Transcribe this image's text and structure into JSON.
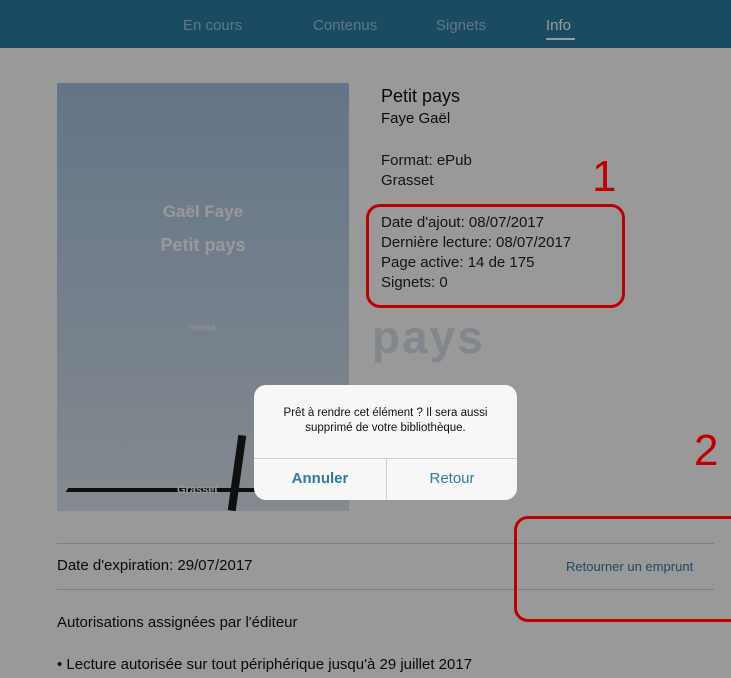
{
  "nav": {
    "tabs": [
      {
        "label": "En cours"
      },
      {
        "label": "Contenus"
      },
      {
        "label": "Signets"
      },
      {
        "label": "Info"
      }
    ],
    "active_tab": "Info"
  },
  "cover": {
    "author": "Gaël Faye",
    "title": "Petit pays",
    "subtitle": "roman",
    "publisher": "Grasset"
  },
  "book": {
    "title": "Petit pays",
    "author": "Faye Gaël",
    "format": "Format: ePub",
    "publisher": "Grasset",
    "date_added": "Date d'ajout: 08/07/2017",
    "last_read": "Dernière lecture: 08/07/2017",
    "active_page": "Page active: 14 de 175",
    "bookmarks": "Signets: 0"
  },
  "watermark": "pays",
  "annotations": {
    "one": "1",
    "two": "2"
  },
  "loan": {
    "expiration": "Date d'expiration: 29/07/2017",
    "return_link": "Retourner un emprunt"
  },
  "permissions": {
    "heading": "Autorisations assignées par l'éditeur",
    "item": "• Lecture autorisée sur tout périphérique jusqu'à 29 juillet 2017"
  },
  "dialog": {
    "message": "Prêt à rendre cet élément ? Il sera aussi supprimé de votre bibliothèque.",
    "cancel_label": "Annuler",
    "ok_label": "Retour"
  },
  "colors": {
    "nav_bg": "#2e7ea3",
    "accent": "#2e7ea3",
    "annotation": "#c00000"
  }
}
